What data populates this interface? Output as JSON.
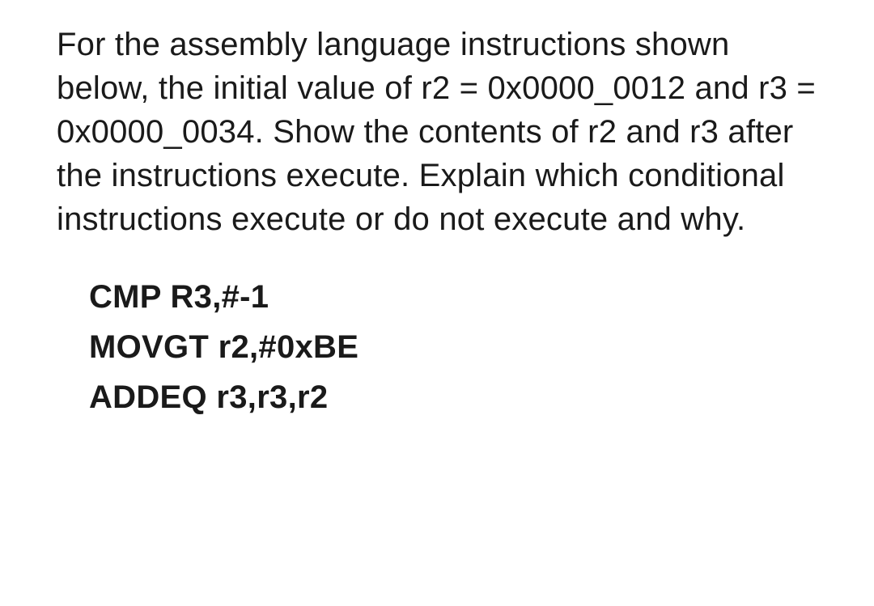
{
  "question": {
    "text": "For the assembly language instructions shown below, the initial value of r2 = 0x0000_0012 and r3 = 0x0000_0034. Show the contents of r2 and r3 after the instructions execute. Explain which conditional instructions execute or do not execute and why."
  },
  "code": {
    "lines": [
      "CMP R3,#-1",
      "MOVGT r2,#0xBE",
      "ADDEQ r3,r3,r2"
    ]
  }
}
